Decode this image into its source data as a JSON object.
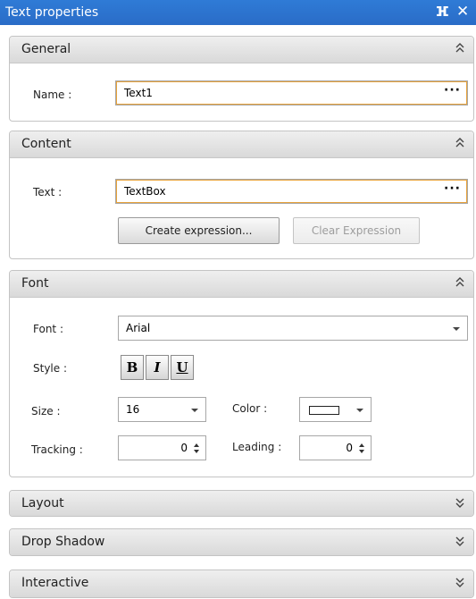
{
  "window": {
    "title": "Text properties"
  },
  "general": {
    "title": "General",
    "name_label": "Name :",
    "name_value": "Text1",
    "ellipsis": "···"
  },
  "content": {
    "title": "Content",
    "text_label": "Text :",
    "text_value": "TextBox",
    "ellipsis": "···",
    "create_expression_label": "Create expression...",
    "clear_expression_label": "Clear Expression"
  },
  "font": {
    "title": "Font",
    "font_label": "Font :",
    "font_value": "Arial",
    "style_label": "Style :",
    "bold_label": "B",
    "italic_label": "I",
    "underline_label": "U",
    "size_label": "Size :",
    "size_value": "16",
    "color_label": "Color :",
    "color_value": "#ffffff",
    "tracking_label": "Tracking :",
    "tracking_value": "0",
    "leading_label": "Leading :",
    "leading_value": "0"
  },
  "collapsed_sections": {
    "layout": "Layout",
    "drop_shadow": "Drop Shadow",
    "interactive": "Interactive"
  },
  "icons": {
    "pin": "pin-icon",
    "close": "close-icon",
    "collapse": "chevron-up-double-icon",
    "expand": "chevron-down-double-icon"
  },
  "colors": {
    "title_bar": "#2f7bd6",
    "focus_border": "#e8a33c"
  }
}
